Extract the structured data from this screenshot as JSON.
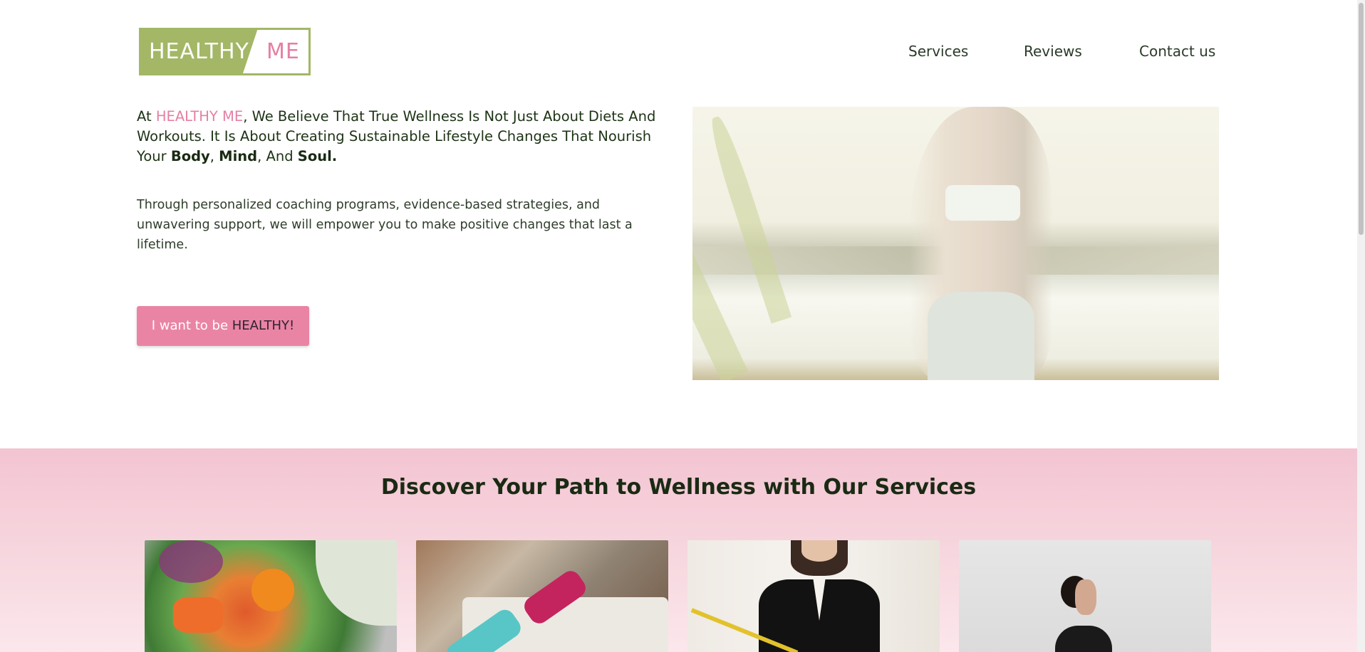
{
  "logo": {
    "word1": "HEALTHY",
    "word2": "ME"
  },
  "nav": {
    "services": "Services",
    "reviews": "Reviews",
    "contact": "Contact us"
  },
  "hero": {
    "intro_prefix": "At ",
    "brand": "HEALTHY ME",
    "intro_mid": ", We Believe That True Wellness Is Not Just About Diets And Workouts. It Is About Creating Sustainable Lifestyle Changes That Nourish Your ",
    "body": "Body",
    "comma1": ", ",
    "mind": "Mind",
    "and": ", And ",
    "soul": "Soul.",
    "sub": "Through personalized coaching programs, evidence-based strategies, and unwavering support, we will empower you to make positive changes that last a lifetime.",
    "cta_prefix": "I want to be ",
    "cta_strong": "HEALTHY!"
  },
  "services": {
    "title": "Discover Your Path to Wellness with Our Services"
  },
  "colors": {
    "brand_green": "#a3b766",
    "brand_pink": "#e57fa4",
    "cta_pink": "#ea84a5",
    "services_bg": "#f3c4d2"
  }
}
